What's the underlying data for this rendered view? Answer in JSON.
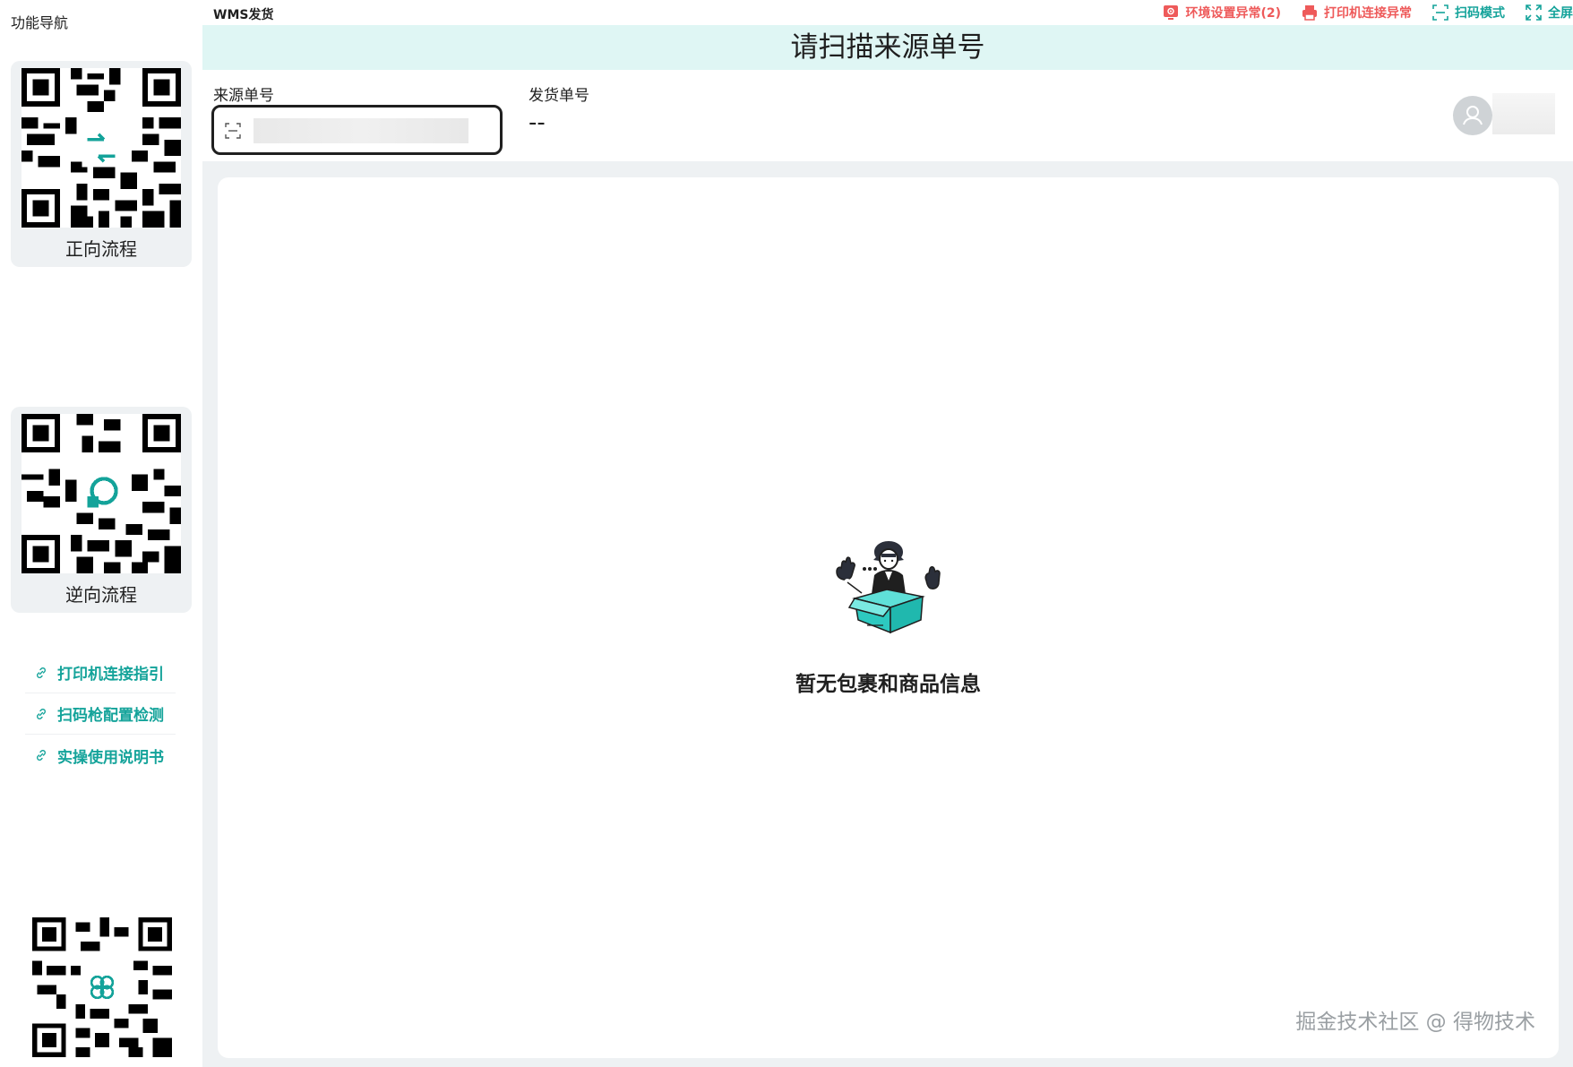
{
  "sidebar": {
    "title": "功能导航",
    "qr_cards": [
      {
        "label": "正向流程"
      },
      {
        "label": "逆向流程"
      }
    ],
    "links": [
      {
        "label": "打印机连接指引"
      },
      {
        "label": "扫码枪配置检测"
      },
      {
        "label": "实操使用说明书"
      }
    ]
  },
  "header": {
    "app_title": "WMS发货",
    "actions": [
      {
        "label": "环境设置异常(2)",
        "status": "warning",
        "icon": "settings-alert-icon"
      },
      {
        "label": "打印机连接异常",
        "status": "warning",
        "icon": "printer-icon"
      },
      {
        "label": "扫码模式",
        "status": "ok",
        "icon": "scan-icon"
      },
      {
        "label": "全屏",
        "status": "ok",
        "icon": "fullscreen-icon"
      }
    ]
  },
  "banner": {
    "prompt": "请扫描来源单号"
  },
  "form": {
    "source_label": "来源单号",
    "ship_label": "发货单号",
    "ship_value": "--"
  },
  "empty_state": {
    "text": "暂无包裹和商品信息"
  },
  "watermark": {
    "text": "掘金技术社区 @ 得物技术"
  },
  "colors": {
    "accent": "#14a39a",
    "warning": "#ee5a5a",
    "banner_bg": "#dff6f4",
    "page_bg": "#eef1f3"
  }
}
